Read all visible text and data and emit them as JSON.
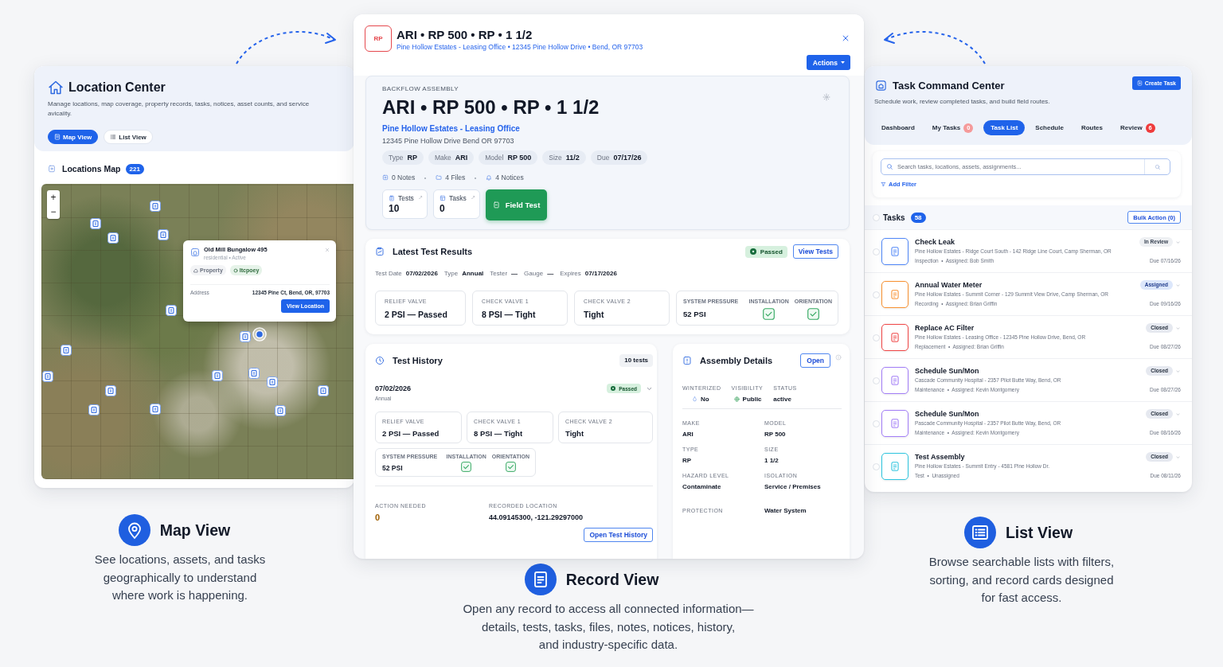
{
  "location_center": {
    "title": "Location Center",
    "description": "Manage locations, map coverage, property records, tasks, notices, asset counts, and service\navicaiity.",
    "view_toggle": [
      {
        "kind": "map",
        "label": "Map View",
        "selected": true
      },
      {
        "kind": "list",
        "label": "List View",
        "selected": false
      }
    ],
    "map_section": {
      "title": "Locations Map",
      "count": "221"
    },
    "map": {
      "zoom_in": "+",
      "zoom_out": "−",
      "popup": {
        "name": "Old Mill Bungalow 495",
        "meta": "residential • Active",
        "tags": [
          {
            "kind": "property",
            "text": "Property"
          },
          {
            "kind": "status",
            "text": "Itcpoey"
          }
        ],
        "address_label": "Address",
        "address": "12345 Pine Ct, Bend, OR, 97703",
        "button": "View Location"
      }
    }
  },
  "record": {
    "badge": "RP",
    "title": "ARI • RP 500 • RP • 1 1/2",
    "subtitle": "Pine Hollow Estates - Leasing Office • 12345 Pine Hollow Drive • Bend, OR 97703",
    "actions_button": "Actions",
    "summary": {
      "eyebrow": "BACKFLOW ASSEMBLY",
      "title": "ARI • RP 500 • RP • 1 1/2",
      "location": "Pine Hollow Estates - Leasing Office",
      "address": "12345 Pine Hollow Drive Bend OR 97703",
      "chips": [
        {
          "label": "Type",
          "value": "RP"
        },
        {
          "label": "Make",
          "value": "ARI"
        },
        {
          "label": "Model",
          "value": "RP 500"
        },
        {
          "label": "Size",
          "value": "11/2"
        },
        {
          "label": "Due",
          "value": "07/17/26"
        }
      ],
      "counts": [
        {
          "kind": "notes",
          "text": "0 Notes"
        },
        {
          "kind": "files",
          "text": "4 Files"
        },
        {
          "kind": "notices",
          "text": "4 Notices"
        }
      ],
      "tiles": [
        {
          "kind": "tests",
          "label": "Tests",
          "value": "10"
        },
        {
          "kind": "tasks",
          "label": "Tasks",
          "value": "0"
        }
      ],
      "field_test_button": "Field Test"
    },
    "latest_results": {
      "title": "Latest Test Results",
      "status": "Passed",
      "view_button": "View Tests",
      "meta": [
        {
          "label": "Test Date",
          "value": "07/02/2026"
        },
        {
          "label": "Type",
          "value": "Annual"
        },
        {
          "label": "Tester",
          "value": "—"
        },
        {
          "label": "Gauge",
          "value": "—"
        },
        {
          "label": "Expires",
          "value": "07/17/2026"
        }
      ],
      "readings": [
        {
          "label": "RELIEF VALVE",
          "value": "2 PSI — Passed"
        },
        {
          "label": "CHECK VALVE 1",
          "value": "8 PSI — Tight"
        },
        {
          "label": "CHECK VALVE 2",
          "value": "Tight"
        }
      ],
      "pressure": {
        "label": "SYSTEM PRESSURE",
        "value": "52 PSI"
      },
      "checks": [
        {
          "label": "INSTALLATION",
          "checked": true
        },
        {
          "label": "ORIENTATION",
          "checked": true
        }
      ]
    },
    "test_history": {
      "title": "Test History",
      "count": "10 tests",
      "entry": {
        "date": "07/02/2026",
        "type": "Annual",
        "status": "Passed",
        "expanded": true,
        "readings": [
          {
            "label": "RELIEF VALVE",
            "value": "2 PSI — Passed"
          },
          {
            "label": "CHECK VALVE 1",
            "value": "8 PSI — Tight"
          },
          {
            "label": "CHECK VALVE 2",
            "value": "Tight"
          }
        ],
        "pressure": {
          "label": "SYSTEM PRESSURE",
          "value": "52 PSI"
        },
        "checks": [
          {
            "label": "INSTALLATION",
            "checked": true
          },
          {
            "label": "ORIENTATION",
            "checked": true
          }
        ]
      },
      "action_needed": {
        "label": "ACTION NEEDED",
        "value": "0"
      },
      "recorded_location": {
        "label": "RECORDED LOCATION",
        "value": "44.09145300, -121.29297000"
      },
      "open_button": "Open Test History"
    },
    "assembly_details": {
      "title": "Assembly Details",
      "open_button": "Open",
      "flags": [
        {
          "kind": "winterized",
          "label": "WINTERIZED",
          "value": "No"
        },
        {
          "kind": "visibility",
          "label": "VISIBILITY",
          "value": "Public"
        },
        {
          "kind": "status",
          "label": "STATUS",
          "value": "active"
        }
      ],
      "fields": [
        {
          "label": "MAKE",
          "value": "ARI"
        },
        {
          "label": "MODEL",
          "value": "RP 500"
        },
        {
          "label": "TYPE",
          "value": "RP"
        },
        {
          "label": "SIZE",
          "value": "1 1/2"
        },
        {
          "label": "HAZARD LEVEL",
          "value": "Contaminate"
        },
        {
          "label": "ISOLATION",
          "value": "Service / Premises"
        }
      ],
      "protection": {
        "label": "PROTECTION",
        "value": "Water System"
      }
    }
  },
  "task_center": {
    "title": "Task Command Center",
    "create_button": "Create Task",
    "description": "Schedule work, review completed tasks, and build field routes.",
    "tabs": [
      {
        "label": "Dashboard",
        "selected": false
      },
      {
        "label": "My Tasks",
        "selected": false,
        "badge": {
          "text": "0",
          "color": "#f59a9a"
        }
      },
      {
        "label": "Task List",
        "selected": true
      },
      {
        "label": "Schedule",
        "selected": false
      },
      {
        "label": "Routes",
        "selected": false
      },
      {
        "label": "Review",
        "selected": false,
        "badge": {
          "text": "6",
          "color": "#ef3b3b"
        }
      }
    ],
    "search": {
      "placeholder": "Search tasks, locations, assets, assignments..."
    },
    "add_filter": "Add Filter",
    "tasks": {
      "title": "Tasks",
      "count": "58",
      "checked": false,
      "bulk_button": "Bulk Action (0)",
      "items": [
        {
          "title": "Check Leak",
          "location": "Pine Hollow Estates - Ridge Court South - 142 Ridge Line Court, Camp Sherman, OR",
          "meta": "Inspection  •  Assigned: Bob Smith",
          "status": "In Review",
          "kind": "review",
          "due": "Due 07/16/26",
          "color": "#4f86f7",
          "checked": false
        },
        {
          "title": "Annual Water Meter",
          "location": "Pine Hollow Estates - Summit Corner - 129 Summit View Drive, Camp Sherman, OR",
          "meta": "Recording  •  Assigned: Brian Griffin",
          "status": "Assigned",
          "kind": "assigned",
          "due": "Due 09/16/26",
          "color": "#f7902f",
          "checked": false
        },
        {
          "title": "Replace AC Filter",
          "location": "Pine Hollow Estates - Leasing Office - 12345 Pine Hollow Drive, Bend, OR",
          "meta": "Replacement  •  Assigned: Brian Griffin",
          "status": "Closed",
          "kind": "closed",
          "due": "Due 08/27/26",
          "color": "#ef4444",
          "checked": false
        },
        {
          "title": "Schedule Sun/Mon",
          "location": "Cascade Community Hospital - 2357 Pilot Butte Way, Bend, OR",
          "meta": "Maintenance  •  Assigned: Kevin Montgomery",
          "status": "Closed",
          "kind": "closed",
          "due": "Due 08/27/26",
          "color": "#a17cf6",
          "checked": false
        },
        {
          "title": "Schedule Sun/Mon",
          "location": "Pascade Community Hospital - 2357 Pilot Butte Way, Bend, OR",
          "meta": "Maintenance  •  Assigned: Kevin Montgomery",
          "status": "Closed",
          "kind": "closed",
          "due": "Due 08/16/26",
          "color": "#a17cf6",
          "checked": false
        },
        {
          "title": "Test Assembly",
          "location": "Pine Hollow Estates - Summit Entry - 4581 Pine Hollow Dr.",
          "meta": "Test  •  Unassigned",
          "status": "Closed",
          "kind": "closed",
          "due": "Due 08/11/26",
          "color": "#2cc4de",
          "checked": false
        }
      ]
    }
  },
  "captions": [
    {
      "kind": "map",
      "title": "Map View",
      "text": "See locations, assets, and tasks\ngeographically to understand\nwhere work is happening."
    },
    {
      "kind": "record",
      "title": "Record View",
      "text": "Open any record to access all connected information—\ndetails, tests, tasks, files, notes, notices, history,\nand industry-specific data."
    },
    {
      "kind": "list",
      "title": "List View",
      "text": "Browse searchable lists with filters,\nsorting, and record cards designed\nfor fast access."
    }
  ]
}
